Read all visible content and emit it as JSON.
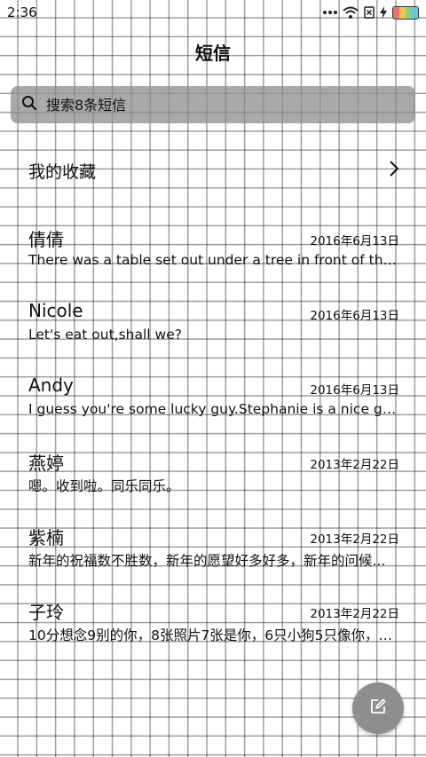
{
  "status_bar": {
    "time": "2:36"
  },
  "header": {
    "title": "短信"
  },
  "search": {
    "placeholder": "搜索8条短信"
  },
  "favorites": {
    "label": "我的收藏"
  },
  "messages": [
    {
      "name": "倩倩",
      "date": "2016年6月13日",
      "preview": "There was a table set out under a tree in front of the house..."
    },
    {
      "name": "Nicole",
      "date": "2016年6月13日",
      "preview": "Let's eat out,shall we?"
    },
    {
      "name": "Andy",
      "date": "2016年6月13日",
      "preview": "I guess you're some lucky guy.Stephanie is a nice girl."
    },
    {
      "name": "燕婷",
      "date": "2013年2月22日",
      "preview": "嗯。收到啦。同乐同乐。"
    },
    {
      "name": "紫楠",
      "date": "2013年2月22日",
      "preview": "新年的祝福数不胜数，新年的愿望好多好多，新年的问候..."
    },
    {
      "name": "子玲",
      "date": "2013年2月22日",
      "preview": "10分想念9别的你，8张照片7张是你，6只小狗5只像你，4..."
    }
  ],
  "colors": {
    "search_bg": "#8c8c8c",
    "fab_bg": "#8e8e8e"
  },
  "icons": {
    "search": "search-icon",
    "chevron": "chevron-right-icon",
    "compose": "compose-icon",
    "signal": "signal-dots-icon",
    "wifi": "wifi-icon",
    "sim": "sim-card-icon",
    "charging": "charging-icon",
    "battery": "battery-icon"
  }
}
